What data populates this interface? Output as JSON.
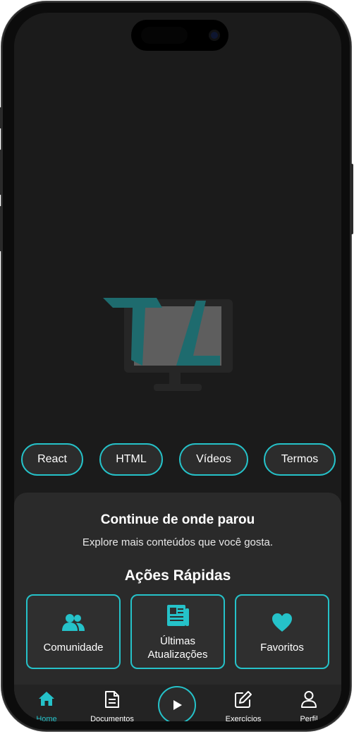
{
  "tags": [
    "React",
    "HTML",
    "Vídeos",
    "Termos"
  ],
  "continue": {
    "title": "Continue de onde parou",
    "subtitle": "Explore mais conteúdos que você gosta."
  },
  "quick_actions": {
    "title": "Ações Rápidas",
    "items": [
      {
        "label": "Comunidade",
        "icon": "people-icon"
      },
      {
        "label": "Últimas Atualizações",
        "icon": "news-icon"
      },
      {
        "label": "Favoritos",
        "icon": "heart-icon"
      }
    ]
  },
  "tabbar": {
    "items": [
      {
        "label": "Home",
        "icon": "home-icon",
        "active": true
      },
      {
        "label": "Documentos",
        "icon": "document-icon"
      },
      {
        "label": "Exercícios",
        "icon": "edit-icon"
      },
      {
        "label": "Perfil",
        "icon": "user-icon"
      }
    ],
    "center_icon": "play-icon"
  },
  "colors": {
    "accent": "#25c2c9",
    "background": "#1b1b1b",
    "card": "#2a2a2a",
    "logo_teal": "#1e6b6e"
  }
}
